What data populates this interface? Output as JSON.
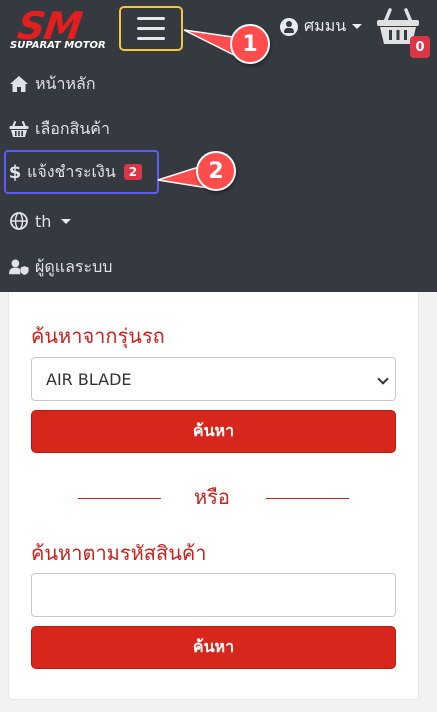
{
  "brand": {
    "logo_text": "SM",
    "logo_subtext": "SUPARAT MOTOR",
    "logo_color": "#e41e1e"
  },
  "header": {
    "menu_icon": "hamburger-menu-icon",
    "user_label": "ศมมน",
    "user_icon": "user-circle-icon",
    "cart_icon": "shopping-basket-icon",
    "cart_count": "0"
  },
  "callouts": [
    {
      "label": "1"
    },
    {
      "label": "2"
    }
  ],
  "nav": {
    "items": [
      {
        "label": "หน้าหลัก",
        "icon": "home-icon"
      },
      {
        "label": "เลือกสินค้า",
        "icon": "basket-icon"
      },
      {
        "label": "แจ้งชำระเงิน",
        "icon": "dollar-icon",
        "badge": "2"
      },
      {
        "label": "th",
        "icon": "globe-icon"
      },
      {
        "label": "ผู้ดูแลระบบ",
        "icon": "user-shield-icon"
      }
    ]
  },
  "search": {
    "by_model_title": "ค้นหาจากรุ่นรถ",
    "model_selected": "AIR BLADE",
    "search_button": "ค้นหา",
    "or_text": "หรือ",
    "by_code_title": "ค้นหาตามรหัสสินค้า",
    "code_value": "",
    "search_button_2": "ค้นหา"
  },
  "colors": {
    "navbar_bg": "#343a40",
    "accent_red": "#d7261b",
    "highlight_yellow": "#f5c542",
    "highlight_blue": "#5b5bf7",
    "callout_red": "#ff4d4d"
  }
}
